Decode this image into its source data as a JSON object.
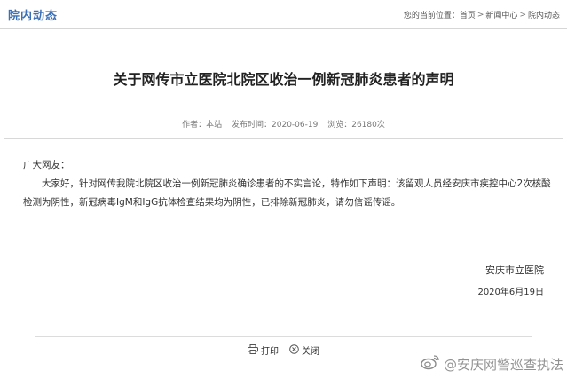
{
  "header": {
    "section_title": "院内动态",
    "breadcrumb": {
      "prefix": "您的当前位置：",
      "items": [
        "首页",
        "新闻中心",
        "院内动态"
      ],
      "separator": ">"
    }
  },
  "article": {
    "title": "关于网传市立医院北院区收治一例新冠肺炎患者的声明",
    "meta": {
      "author": "作者：本站",
      "published": "发布时间：2020-06-19",
      "views": "浏览：26180次"
    },
    "salutation": "广大网友：",
    "paragraph": "大家好，针对网传我院北院区收治一例新冠肺炎确诊患者的不实言论，特作如下声明：该留观人员经安庆市疾控中心2次核酸检测为阴性，新冠病毒IgM和IgG抗体检查结果均为阴性，已排除新冠肺炎，请勿信谣传谣。",
    "signature_org": "安庆市立医院",
    "signature_date": "2020年6月19日"
  },
  "actions": {
    "print_label": "打印",
    "close_label": "关闭",
    "print_icon": "printer-icon",
    "close_icon": "close-circle-icon"
  },
  "watermark": {
    "text": "@安庆网警巡查执法",
    "icon": "weibo-icon"
  },
  "colors": {
    "section_title": "#3b6fb6",
    "divider": "#d8d8d8"
  }
}
